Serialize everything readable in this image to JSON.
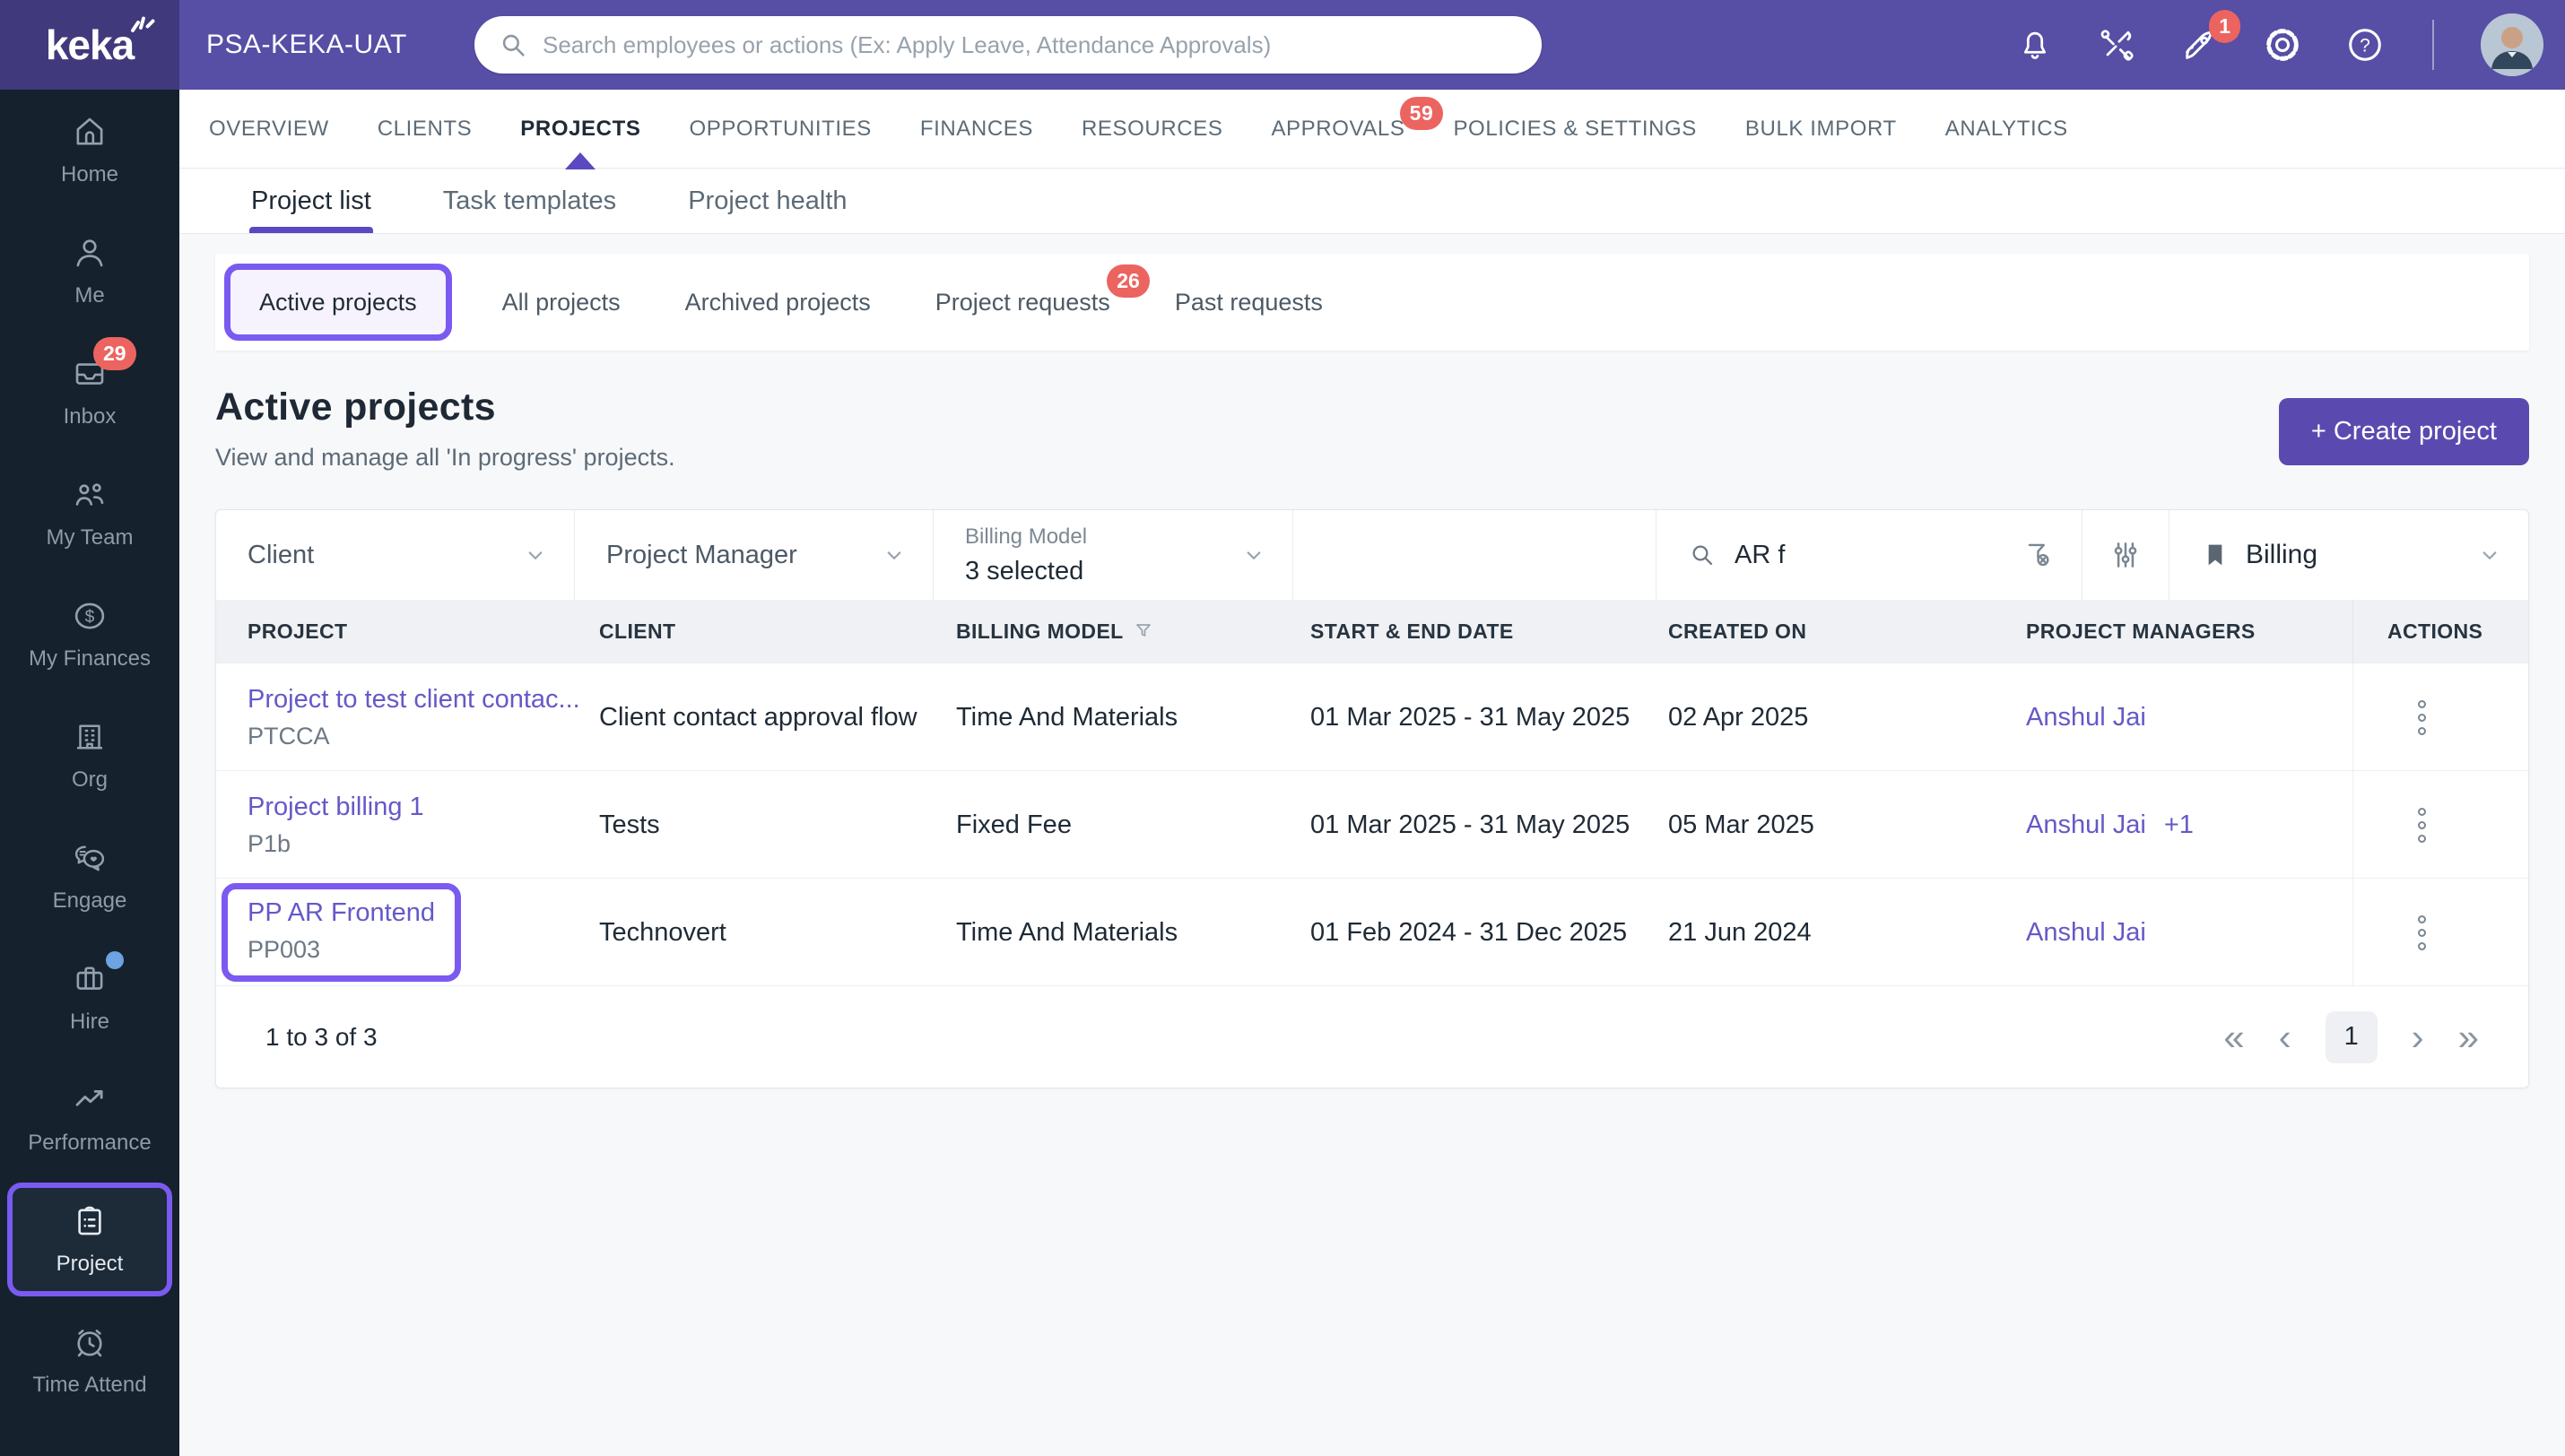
{
  "topbar": {
    "logo_text": "keka",
    "workspace_name": "PSA-KEKA-UAT",
    "search_placeholder": "Search employees or actions (Ex: Apply Leave, Attendance Approvals)",
    "rocket_badge": "1",
    "icons": [
      "bell-icon",
      "tools-icon",
      "rocket-icon",
      "settings-gear-icon",
      "help-icon",
      "avatar"
    ]
  },
  "sidebar": {
    "items": [
      {
        "label": "Home",
        "icon": "home-icon"
      },
      {
        "label": "Me",
        "icon": "person-icon"
      },
      {
        "label": "Inbox",
        "icon": "inbox-tray-icon",
        "badge": "29"
      },
      {
        "label": "My Team",
        "icon": "people-icon"
      },
      {
        "label": "My Finances",
        "icon": "dollar-circle-icon"
      },
      {
        "label": "Org",
        "icon": "building-icon"
      },
      {
        "label": "Engage",
        "icon": "chat-bubbles-icon"
      },
      {
        "label": "Hire",
        "icon": "briefcase-icon",
        "dot": true
      },
      {
        "label": "Performance",
        "icon": "trend-line-icon"
      },
      {
        "label": "Project",
        "icon": "clipboard-icon",
        "active": true,
        "annotated": true
      },
      {
        "label": "Time Attend",
        "icon": "alarm-clock-icon"
      }
    ]
  },
  "nav": {
    "items": [
      {
        "label": "OVERVIEW"
      },
      {
        "label": "CLIENTS"
      },
      {
        "label": "PROJECTS",
        "active": true
      },
      {
        "label": "OPPORTUNITIES"
      },
      {
        "label": "FINANCES"
      },
      {
        "label": "RESOURCES"
      },
      {
        "label": "APPROVALS",
        "badge": "59"
      },
      {
        "label": "POLICIES & SETTINGS"
      },
      {
        "label": "BULK IMPORT"
      },
      {
        "label": "ANALYTICS"
      }
    ]
  },
  "subtabs": {
    "items": [
      {
        "label": "Project list",
        "active": true
      },
      {
        "label": "Task templates"
      },
      {
        "label": "Project health"
      }
    ]
  },
  "filter_tabs": {
    "items": [
      {
        "label": "Active projects",
        "active": true,
        "annotated": true
      },
      {
        "label": "All projects"
      },
      {
        "label": "Archived projects"
      },
      {
        "label": "Project requests",
        "badge": "26"
      },
      {
        "label": "Past requests"
      }
    ]
  },
  "page_header": {
    "title": "Active projects",
    "subtitle": "View and manage all 'In progress' projects.",
    "create_button_label": "+ Create project"
  },
  "filters": {
    "client_label": "Client",
    "project_manager_label": "Project Manager",
    "billing_model_label": "Billing Model",
    "billing_model_value": "3 selected",
    "search_value": "AR f",
    "search_icons": [
      "search-icon",
      "clear-filter-icon"
    ],
    "adjustments_icon": "column-settings-icon",
    "view_icon": "bookmark-icon",
    "view_label": "Billing"
  },
  "table": {
    "headers": {
      "project": "PROJECT",
      "client": "CLIENT",
      "billing_model": "BILLING MODEL",
      "dates": "START & END DATE",
      "created": "CREATED ON",
      "managers": "PROJECT MANAGERS",
      "actions": "ACTIONS"
    },
    "rows": [
      {
        "project": "Project to test client contac...",
        "code": "PTCCA",
        "client": "Client contact approval flow",
        "billing_model": "Time And Materials",
        "dates": "01 Mar 2025 - 31 May 2025",
        "created": "02 Apr 2025",
        "managers": "Anshul Jai",
        "managers_extra": ""
      },
      {
        "project": "Project billing 1",
        "code": "P1b",
        "client": "Tests",
        "billing_model": "Fixed Fee",
        "dates": "01 Mar 2025 - 31 May 2025",
        "created": "05 Mar 2025",
        "managers": "Anshul Jai",
        "managers_extra": "+1"
      },
      {
        "project": "PP AR Frontend",
        "code": "PP003",
        "client": "Technovert",
        "billing_model": "Time And Materials",
        "dates": "01 Feb 2024 - 31 Dec 2025",
        "created": "21 Jun 2024",
        "managers": "Anshul Jai",
        "managers_extra": "",
        "annotated": true
      }
    ]
  },
  "pagination": {
    "summary": "1 to 3 of 3",
    "current_page": "1",
    "first_icon": "«",
    "prev_icon": "‹",
    "next_icon": "›",
    "last_icon": "»"
  },
  "colors": {
    "topbar_purple": "#574ea6",
    "logo_purple": "#403a7c",
    "sidebar_navy": "#15212d",
    "accent_purple": "#5a4ab0",
    "annotation_purple": "#7a5af0",
    "link_purple": "#6459c8",
    "badge_red": "#ec6460"
  }
}
